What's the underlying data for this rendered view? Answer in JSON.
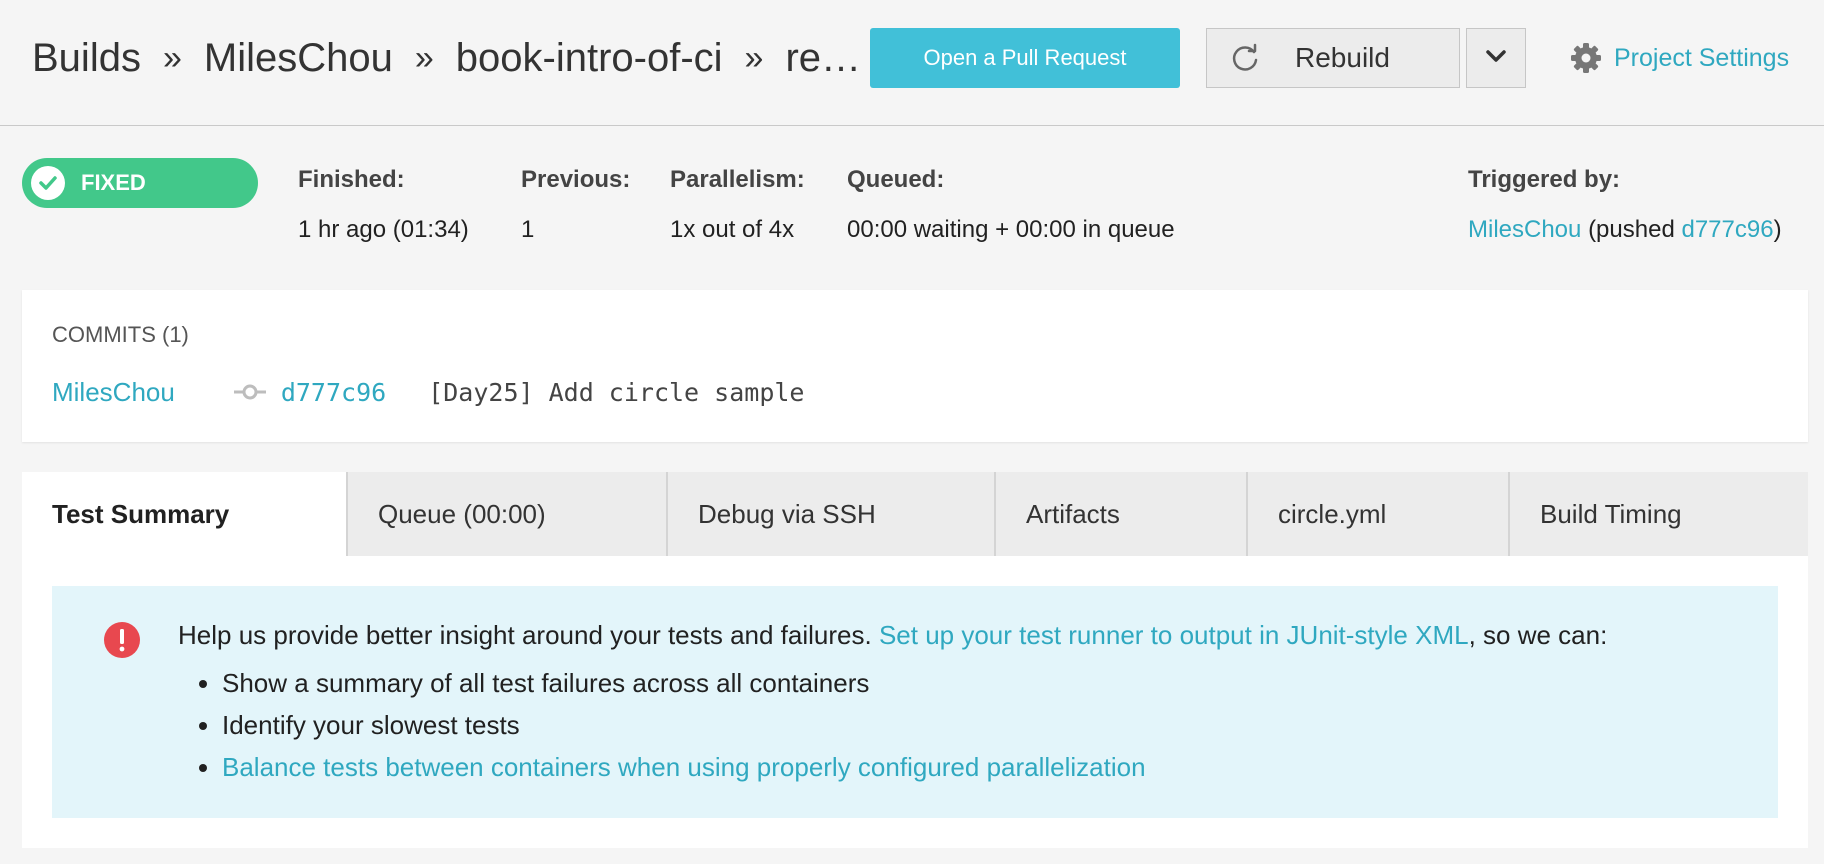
{
  "breadcrumb": {
    "items": [
      "Builds",
      "MilesChou",
      "book-intro-of-ci",
      "re…"
    ],
    "separator": "»"
  },
  "header": {
    "open_pr_label": "Open a Pull Request",
    "rebuild_label": "Rebuild",
    "project_settings_label": "Project Settings"
  },
  "status": {
    "badge": "FIXED",
    "finished": {
      "label": "Finished:",
      "value": "1 hr ago (01:34)"
    },
    "previous": {
      "label": "Previous:",
      "value": "1"
    },
    "parallelism": {
      "label": "Parallelism:",
      "value": "1x out of 4x"
    },
    "queued": {
      "label": "Queued:",
      "value": "00:00 waiting + 00:00 in queue"
    },
    "triggered": {
      "label": "Triggered by:",
      "user": "MilesChou",
      "pushed_prefix": "(pushed ",
      "sha": "d777c96",
      "suffix": ")"
    }
  },
  "commits": {
    "title": "COMMITS (1)",
    "author": "MilesChou",
    "sha": "d777c96",
    "message": "[Day25] Add circle sample"
  },
  "tabs": [
    {
      "label": "Test Summary"
    },
    {
      "label": "Queue (00:00)"
    },
    {
      "label": "Debug via SSH"
    },
    {
      "label": "Artifacts"
    },
    {
      "label": "circle.yml"
    },
    {
      "label": "Build Timing"
    }
  ],
  "info": {
    "line1_text": "Help us provide better insight around your tests and failures. ",
    "line1_link": "Set up your test runner to output in JUnit-style XML",
    "line1_suffix": ", so we can:",
    "bullets": [
      "Show a summary of all test failures across all containers",
      "Identify your slowest tests"
    ],
    "bullet_link": "Balance tests between containers when using properly configured parallelization"
  },
  "colors": {
    "accent": "#2fa8c0",
    "primary_button": "#41c0d8",
    "success": "#42c88a",
    "alert": "#e8484f",
    "info_bg": "#e3f5fa"
  },
  "icons": [
    "refresh-icon",
    "chevron-down-icon",
    "gear-icon",
    "check-icon",
    "commit-icon",
    "alert-icon"
  ]
}
